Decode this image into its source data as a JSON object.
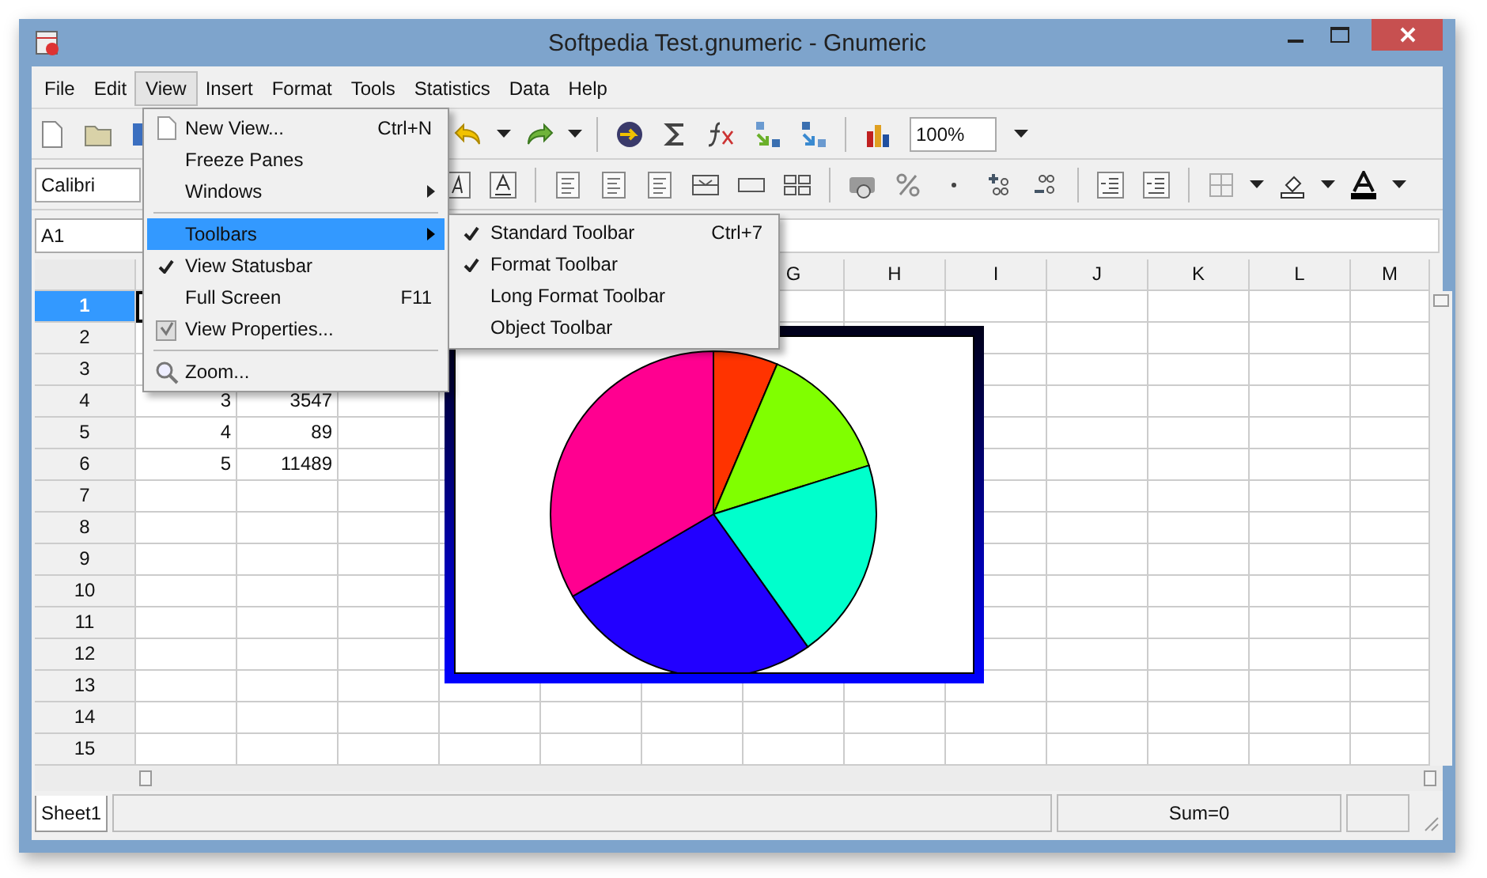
{
  "window": {
    "title": "Softpedia Test.gnumeric - Gnumeric"
  },
  "menu_bar": [
    {
      "label": "File",
      "selected": false
    },
    {
      "label": "Edit",
      "selected": false
    },
    {
      "label": "View",
      "selected": true
    },
    {
      "label": "Insert",
      "selected": false
    },
    {
      "label": "Format",
      "selected": false
    },
    {
      "label": "Tools",
      "selected": false
    },
    {
      "label": "Statistics",
      "selected": false
    },
    {
      "label": "Data",
      "selected": false
    },
    {
      "label": "Help",
      "selected": false
    }
  ],
  "standard_toolbar": {
    "zoom_value": "100%"
  },
  "format_toolbar": {
    "font_value": "Calibri"
  },
  "formula_bar": {
    "cell_name": "A1"
  },
  "columns": [
    "G",
    "H",
    "I",
    "J",
    "K",
    "L",
    "M"
  ],
  "rows": [
    {
      "header": "1",
      "selected": true,
      "cells": []
    },
    {
      "header": "2",
      "selected": false,
      "cells": []
    },
    {
      "header": "3",
      "selected": false,
      "cells": []
    },
    {
      "header": "4",
      "selected": false,
      "cells": [
        "3",
        "3547"
      ]
    },
    {
      "header": "5",
      "selected": false,
      "cells": [
        "4",
        "89"
      ]
    },
    {
      "header": "6",
      "selected": false,
      "cells": [
        "5",
        "11489"
      ]
    },
    {
      "header": "7",
      "selected": false,
      "cells": []
    },
    {
      "header": "8",
      "selected": false,
      "cells": []
    },
    {
      "header": "9",
      "selected": false,
      "cells": []
    },
    {
      "header": "10",
      "selected": false,
      "cells": []
    },
    {
      "header": "11",
      "selected": false,
      "cells": []
    },
    {
      "header": "12",
      "selected": false,
      "cells": []
    },
    {
      "header": "13",
      "selected": false,
      "cells": []
    },
    {
      "header": "14",
      "selected": false,
      "cells": []
    },
    {
      "header": "15",
      "selected": false,
      "cells": []
    }
  ],
  "view_menu": [
    {
      "kind": "item",
      "label": "New View...",
      "shortcut": "Ctrl+N",
      "checked": false,
      "submenu": false,
      "selected": false
    },
    {
      "kind": "item",
      "label": "Freeze Panes",
      "checked": false,
      "submenu": false,
      "selected": false
    },
    {
      "kind": "item",
      "label": "Windows",
      "checked": false,
      "submenu": true,
      "selected": false
    },
    {
      "kind": "separator"
    },
    {
      "kind": "item",
      "label": "Toolbars",
      "checked": false,
      "submenu": true,
      "selected": true
    },
    {
      "kind": "item",
      "label": "View Statusbar",
      "checked": true,
      "submenu": false,
      "selected": false
    },
    {
      "kind": "item",
      "label": "Full Screen",
      "shortcut": "F11",
      "checked": false,
      "submenu": false,
      "selected": false
    },
    {
      "kind": "item",
      "label": "View Properties...",
      "checked": false,
      "submenu": false,
      "selected": false
    },
    {
      "kind": "separator"
    },
    {
      "kind": "item",
      "label": "Zoom...",
      "checked": false,
      "submenu": false,
      "selected": false
    }
  ],
  "toolbars_submenu": [
    {
      "label": "Standard Toolbar",
      "shortcut": "Ctrl+7",
      "checked": true
    },
    {
      "label": "Format Toolbar",
      "checked": true
    },
    {
      "label": "Long Format Toolbar",
      "checked": false
    },
    {
      "label": "Object Toolbar",
      "checked": false
    }
  ],
  "sheet_tabs": [
    {
      "label": "Sheet1",
      "selected": true
    }
  ],
  "status_bar": {
    "sum": "Sum=0"
  }
}
